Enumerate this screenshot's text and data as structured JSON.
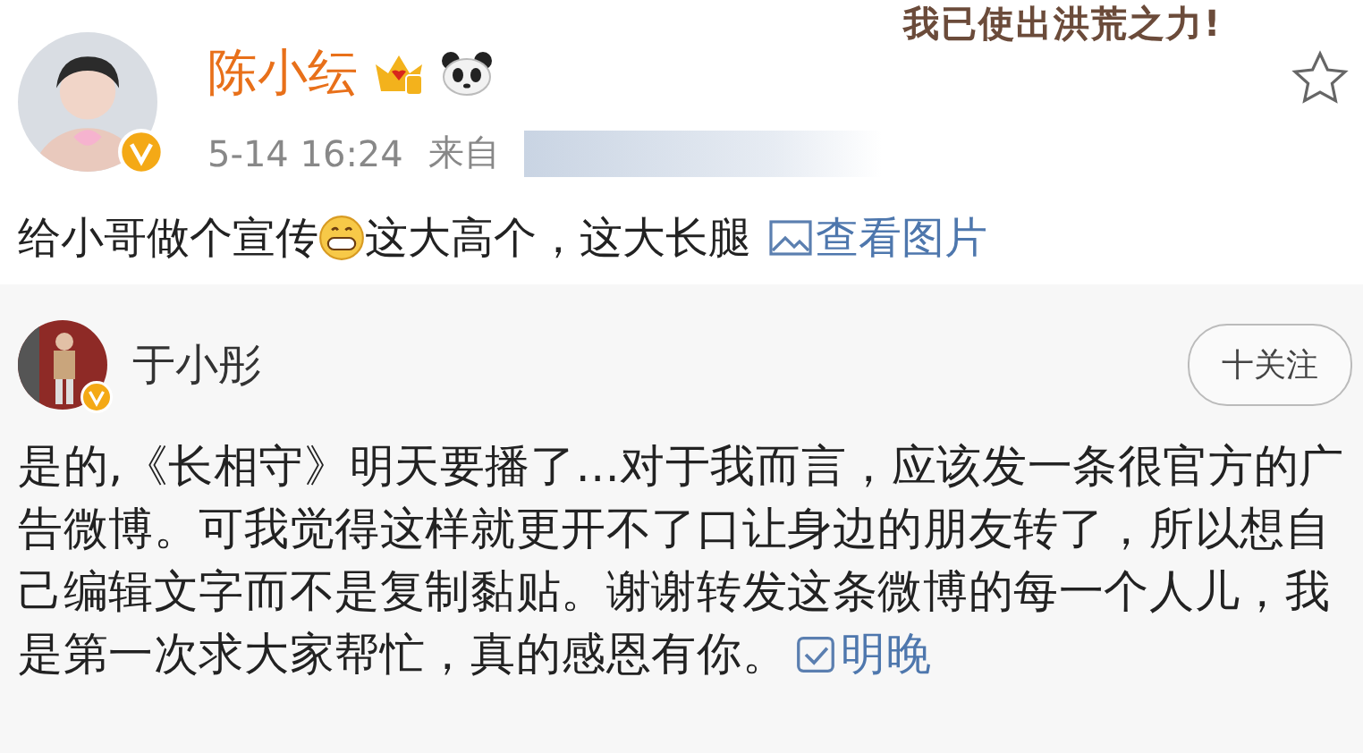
{
  "sticker": {
    "text": "我已使出洪荒之力!"
  },
  "post": {
    "author": "陈小纭",
    "verified": true,
    "time": "5-14 16:24",
    "source_label": "来自",
    "text_before": "给小哥做个宣传",
    "text_after": "这大高个，这大长腿",
    "link": "查看图片"
  },
  "repost": {
    "author": "于小彤",
    "verified": true,
    "follow_button": "十关注",
    "text": "是的,《长相守》明天要播了...对于我而言，应该发一条很官方的广告微博。可我觉得这样就更开不了口让身边的朋友转了，所以想自己编辑文字而不是复制黏贴。谢谢转发这条微博的每一个人儿，我是第一次求大家帮忙，真的感恩有你。",
    "link": "明晚"
  }
}
